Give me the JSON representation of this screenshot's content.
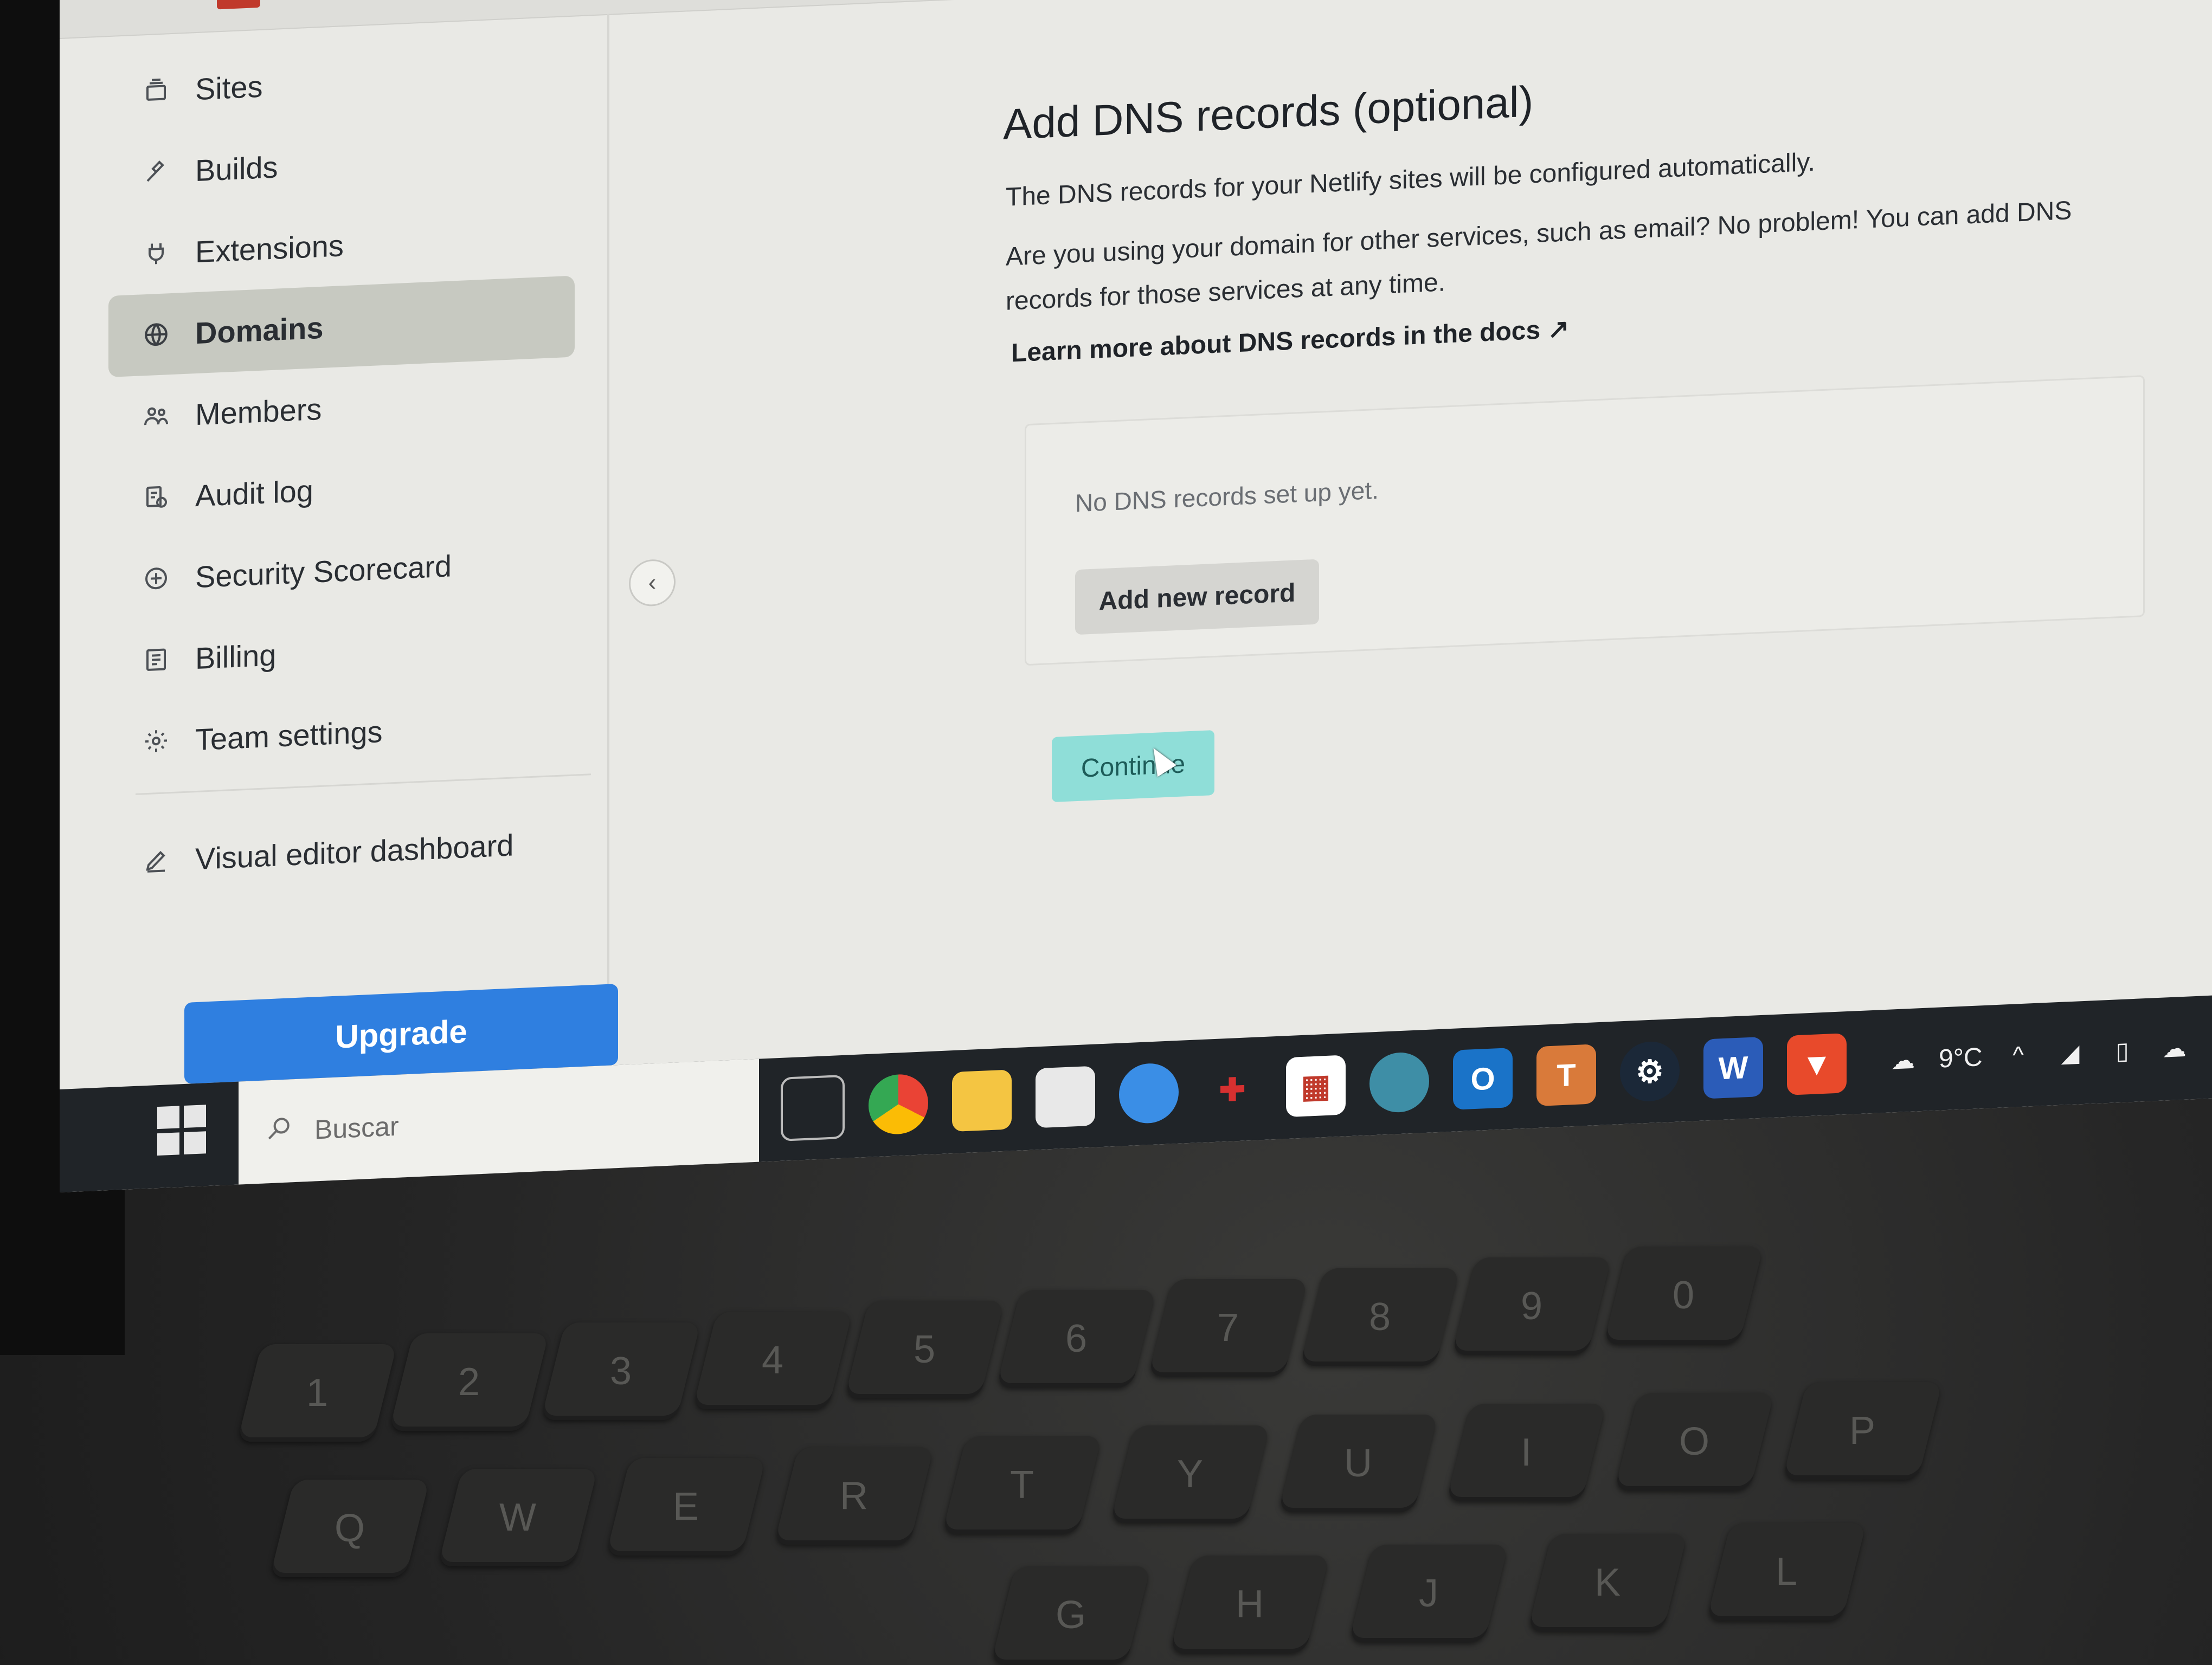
{
  "sidebar": {
    "items": [
      {
        "label": "Sites",
        "icon": "sites-icon"
      },
      {
        "label": "Builds",
        "icon": "builds-icon"
      },
      {
        "label": "Extensions",
        "icon": "extensions-icon"
      },
      {
        "label": "Domains",
        "icon": "domains-icon",
        "active": true
      },
      {
        "label": "Members",
        "icon": "members-icon"
      },
      {
        "label": "Audit log",
        "icon": "audit-log-icon"
      },
      {
        "label": "Security Scorecard",
        "icon": "security-scorecard-icon"
      },
      {
        "label": "Billing",
        "icon": "billing-icon"
      },
      {
        "label": "Team settings",
        "icon": "gear-icon"
      }
    ],
    "visual_editor": {
      "label": "Visual editor dashboard",
      "icon": "pencil-icon"
    },
    "upgrade_label": "Upgrade"
  },
  "main": {
    "title": "Add DNS records (optional)",
    "intro": "The DNS records for your Netlify sites will be configured automatically.",
    "body_line1": "Are you using your domain for other services, such as email? No problem! You can add DNS",
    "body_line2": "records for those services at any time.",
    "learn_more": "Learn more about DNS records in the docs",
    "learn_more_arrow": "↗",
    "empty_state": "No DNS records set up yet.",
    "add_record_label": "Add new record",
    "continue_label": "Continue"
  },
  "taskbar": {
    "search_placeholder": "Buscar",
    "temperature": "9°C",
    "apps": [
      "task-view",
      "chrome",
      "file-explorer",
      "microsoft-store",
      "edge-legacy",
      "puzzle-app",
      "gift-app",
      "edge",
      "outlook",
      "teams",
      "steam",
      "word",
      "brave"
    ]
  },
  "keyboard": {
    "row1": [
      "1",
      "2",
      "3",
      "4",
      "5",
      "6",
      "7",
      "8",
      "9",
      "0"
    ],
    "row2": [
      "Q",
      "W",
      "E",
      "R",
      "T",
      "Y",
      "U",
      "I",
      "O",
      "P"
    ],
    "row3": [
      "G",
      "H",
      "J",
      "K",
      "L"
    ]
  },
  "colors": {
    "accent_blue": "#2f7fe0",
    "continue_teal": "#8fded8",
    "active_nav": "#c7c9c1"
  }
}
